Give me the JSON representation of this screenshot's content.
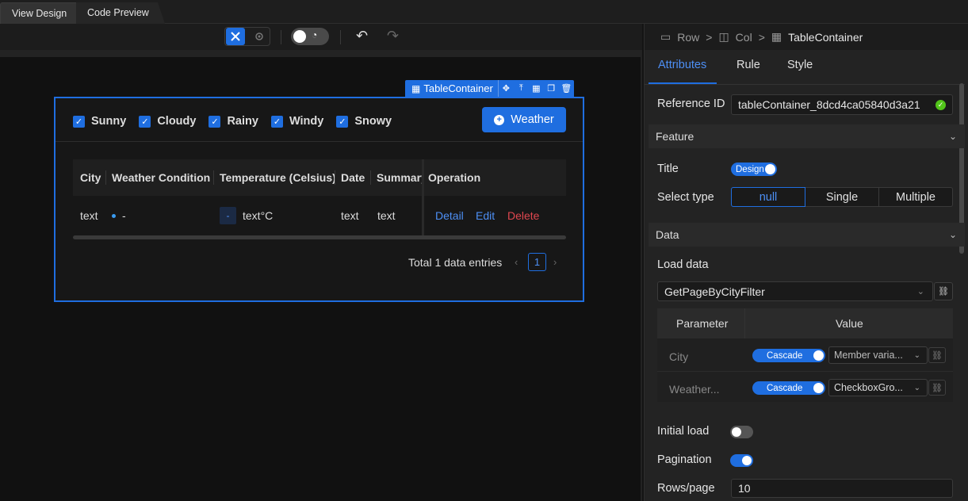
{
  "tabs": {
    "view_design": "View Design",
    "code_preview": "Code Preview"
  },
  "toolbar": {
    "undo_icon": "undo-icon",
    "redo_icon": "redo-icon"
  },
  "container": {
    "label": "TableContainer",
    "filters": [
      "Sunny",
      "Cloudy",
      "Rainy",
      "Windy",
      "Snowy"
    ],
    "add_button": "Weather",
    "columns": [
      "City",
      "Weather Condition",
      "Temperature (Celsius)",
      "Date",
      "Summary",
      "Operation"
    ],
    "row": {
      "city": "text",
      "condition": "-",
      "temp_tag": "-",
      "temp": "text°C",
      "date": "text",
      "summary": "text",
      "actions": [
        "Detail",
        "Edit",
        "Delete"
      ]
    },
    "total": "Total 1 data entries",
    "page": "1"
  },
  "panel": {
    "breadcrumb": [
      "Row",
      "Col",
      "TableContainer"
    ],
    "tabs": [
      "Attributes",
      "Rule",
      "Style"
    ],
    "reference_label": "Reference ID",
    "reference_value": "tableContainer_8dcd4ca05840d3a21",
    "feature_section": "Feature",
    "title_label": "Title",
    "title_switch": "Design",
    "select_type_label": "Select type",
    "select_options": [
      "null",
      "Single",
      "Multiple"
    ],
    "data_section": "Data",
    "load_data_label": "Load data",
    "load_data_value": "GetPageByCityFilter",
    "param_header": "Parameter",
    "value_header": "Value",
    "params": [
      {
        "name": "City",
        "mode": "Cascade",
        "value": "Member varia..."
      },
      {
        "name": "Weather...",
        "mode": "Cascade",
        "value": "CheckboxGro..."
      }
    ],
    "initial_load_label": "Initial load",
    "pagination_label": "Pagination",
    "rows_label": "Rows/page",
    "rows_value": "10"
  },
  "colors": {
    "accent": "#1f6ee0",
    "delete": "#e0474f",
    "success": "#52c41a"
  }
}
